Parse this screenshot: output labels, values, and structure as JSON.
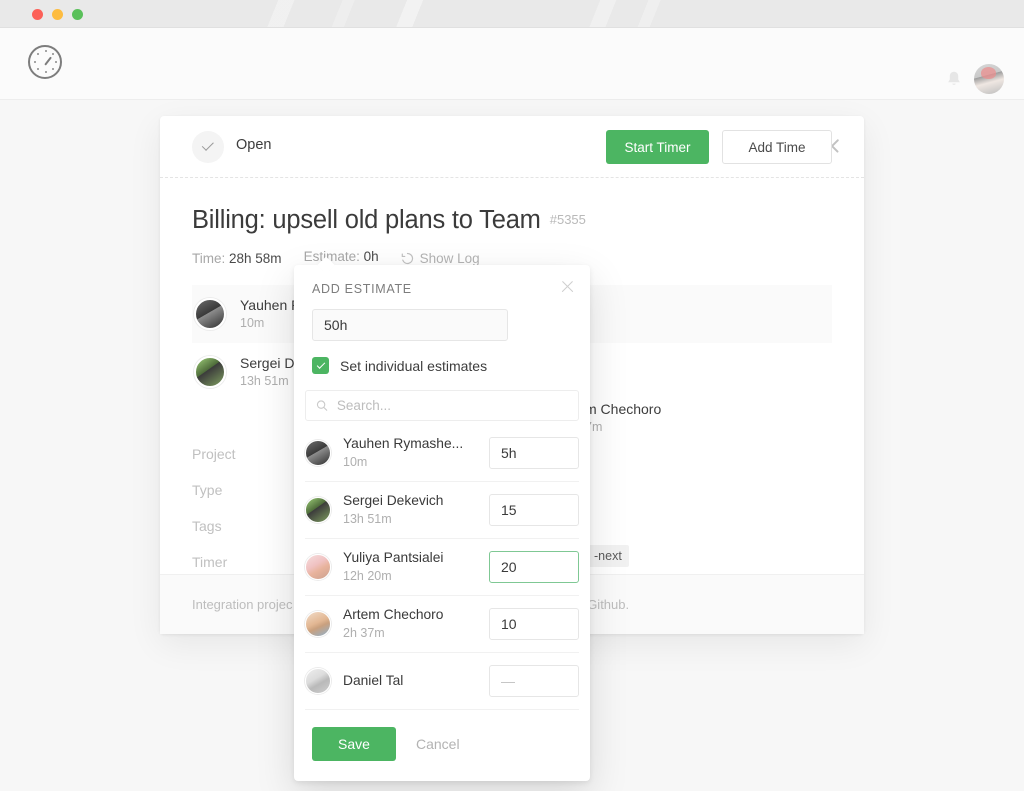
{
  "window": {
    "traffic_lights": [
      "close",
      "minimize",
      "maximize"
    ],
    "logo_name": "timer-logo",
    "bell_icon": "bell-icon",
    "avatar_icon": "user-avatar"
  },
  "card": {
    "status_label": "Open",
    "status_icon": "check-circle-icon",
    "more_icon": "ellipsis-icon",
    "close_icon": "close-icon",
    "title": "Billing: upsell old plans to Team",
    "task_id": "#5355",
    "time_label": "Time:",
    "time_value": "28h 58m",
    "estimate_label": "Estimate:",
    "estimate_value": "0h",
    "show_log": "Show Log",
    "show_log_icon": "history-icon",
    "start_timer": "Start Timer",
    "add_time": "Add Time",
    "field_labels": [
      "Project",
      "Type",
      "Tags",
      "Timer"
    ],
    "tag_chip": "-next",
    "footer_text_left": "Integration projec",
    "footer_text_right": "v available through Github.",
    "assignees": [
      {
        "name": "Yauhen Ry",
        "time": "10m",
        "avatar": "av-yauhen"
      },
      {
        "name": "Sergei Del",
        "time": "13h 51m",
        "avatar": "av-sergei"
      }
    ],
    "hidden_row": {
      "name": "m Chechoro",
      "time": "7m"
    }
  },
  "popover": {
    "title": "ADD ESTIMATE",
    "close_icon": "close-icon",
    "total_estimate": "50h",
    "individual_label": "Set individual estimates",
    "individual_checked": true,
    "search_placeholder": "Search...",
    "search_value": "",
    "search_icon": "search-icon",
    "save_label": "Save",
    "cancel_label": "Cancel",
    "accent_color": "#4cb562",
    "focus_border_color": "#7fc894",
    "people": [
      {
        "name": "Yauhen Rymashe...",
        "time": "10m",
        "estimate": "5h",
        "placeholder": "",
        "focused": false,
        "avatar": "av-yauhen"
      },
      {
        "name": "Sergei Dekevich",
        "time": "13h 51m",
        "estimate": "15",
        "placeholder": "",
        "focused": false,
        "avatar": "av-sergei"
      },
      {
        "name": "Yuliya Pantsialei",
        "time": "12h 20m",
        "estimate": "20",
        "placeholder": "",
        "focused": true,
        "avatar": "av-yuliya"
      },
      {
        "name": "Artem Chechoro",
        "time": "2h 37m",
        "estimate": "10",
        "placeholder": "",
        "focused": false,
        "avatar": "av-artem"
      },
      {
        "name": "Daniel Tal",
        "time": "",
        "estimate": "",
        "placeholder": "—",
        "focused": false,
        "avatar": "av-daniel"
      }
    ]
  }
}
